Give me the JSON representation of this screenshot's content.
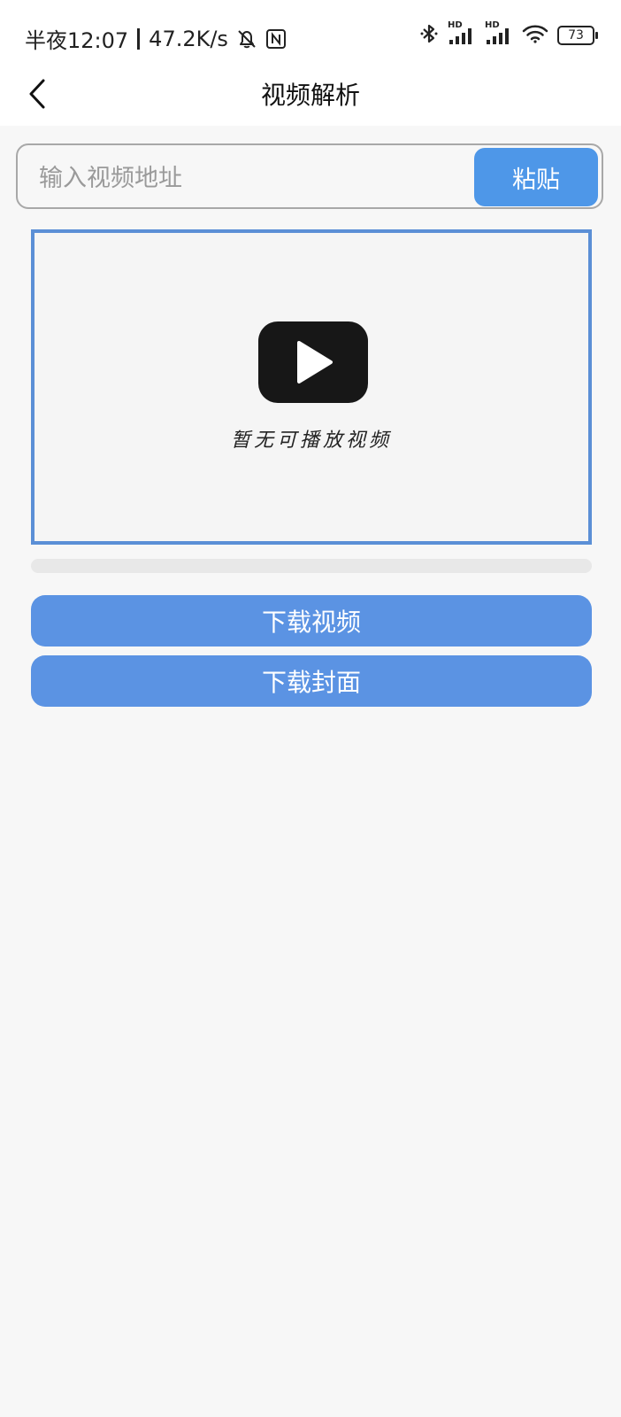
{
  "status_bar": {
    "time": "半夜12:07",
    "speed": "47.2K/s",
    "signal_label_1": "HD",
    "signal_label_2": "HD",
    "battery": "73",
    "icons": [
      "mute-bell-icon",
      "nfc-icon",
      "bluetooth-icon",
      "signal-icon",
      "signal-icon",
      "wifi-icon",
      "battery-icon"
    ]
  },
  "header": {
    "title": "视频解析",
    "back_icon": "chevron-left-icon"
  },
  "url_input": {
    "value": "",
    "placeholder": "输入视频地址",
    "paste_label": "粘贴"
  },
  "player": {
    "icon": "play-icon",
    "empty_text": "暂无可播放视频"
  },
  "progress": {
    "value": 0
  },
  "actions": {
    "download_video_label": "下载视频",
    "download_cover_label": "下载封面"
  },
  "colors": {
    "accent": "#4e97e8",
    "button": "#5b93e3",
    "player_border": "#5b8fd6",
    "background": "#f7f7f7"
  }
}
